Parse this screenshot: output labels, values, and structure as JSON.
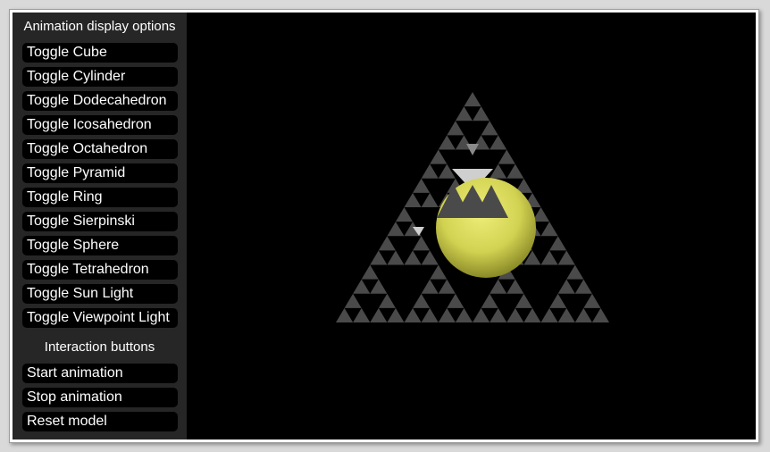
{
  "sidebar": {
    "display_title": "Animation display options",
    "display_buttons": [
      {
        "label": "Toggle Cube"
      },
      {
        "label": "Toggle Cylinder"
      },
      {
        "label": "Toggle Dodecahedron"
      },
      {
        "label": "Toggle Icosahedron"
      },
      {
        "label": "Toggle Octahedron"
      },
      {
        "label": "Toggle Pyramid"
      },
      {
        "label": "Toggle Ring"
      },
      {
        "label": "Toggle Sierpinski"
      },
      {
        "label": "Toggle Sphere"
      },
      {
        "label": "Toggle Tetrahedron"
      },
      {
        "label": "Toggle Sun Light"
      },
      {
        "label": "Toggle Viewpoint Light"
      }
    ],
    "interaction_title": "Interaction buttons",
    "interaction_buttons": [
      {
        "label": "Start animation"
      },
      {
        "label": "Stop animation"
      },
      {
        "label": "Reset model"
      }
    ]
  },
  "scene": {
    "objects": [
      "sierpinski-pyramid",
      "sphere"
    ],
    "colors": {
      "background": "#000000",
      "sidebar": "#262626",
      "button": "#000000",
      "button_text": "#ffffff",
      "sierpinski_face": "#4a4a4a",
      "sierpinski_highlight": "#cfcfcf",
      "sphere": "#d6d65a"
    }
  }
}
